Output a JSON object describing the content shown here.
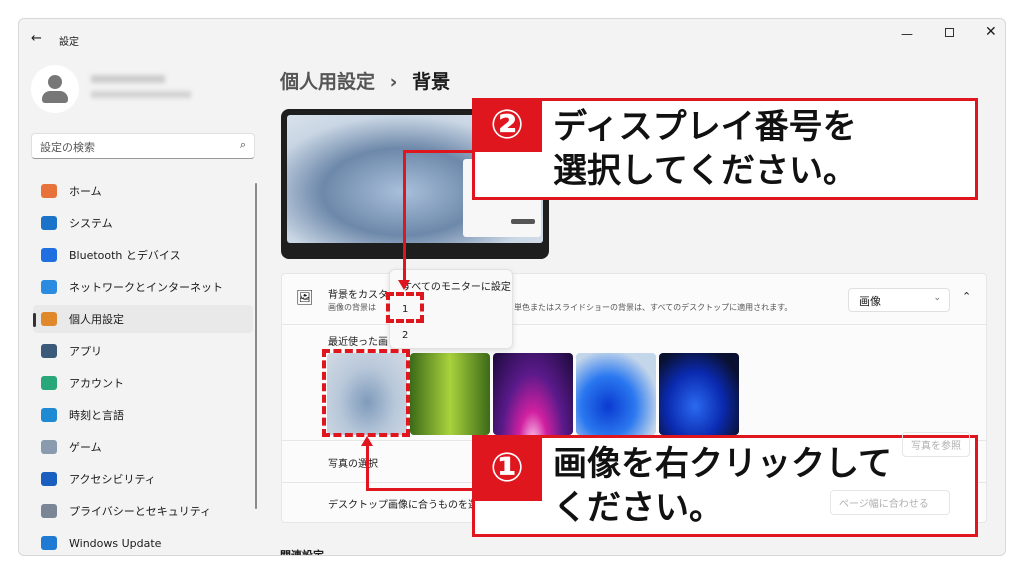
{
  "window": {
    "title": "設定",
    "controls": [
      "minimize",
      "maximize",
      "close"
    ]
  },
  "search": {
    "placeholder": "設定の検索"
  },
  "sidebar": {
    "items": [
      {
        "label": "ホーム",
        "icon": "home-icon",
        "color": "#e8733a"
      },
      {
        "label": "システム",
        "icon": "system-icon",
        "color": "#1a73c9"
      },
      {
        "label": "Bluetooth とデバイス",
        "icon": "bluetooth-icon",
        "color": "#1f6fe0"
      },
      {
        "label": "ネットワークとインターネット",
        "icon": "wifi-icon",
        "color": "#2a8be0"
      },
      {
        "label": "個人用設定",
        "icon": "brush-icon",
        "color": "#e0882c"
      },
      {
        "label": "アプリ",
        "icon": "apps-icon",
        "color": "#3b5a7a"
      },
      {
        "label": "アカウント",
        "icon": "account-icon",
        "color": "#28a77a"
      },
      {
        "label": "時刻と言語",
        "icon": "clock-globe-icon",
        "color": "#1f8ad4"
      },
      {
        "label": "ゲーム",
        "icon": "gamepad-icon",
        "color": "#8a9bb0"
      },
      {
        "label": "アクセシビリティ",
        "icon": "accessibility-icon",
        "color": "#1a5fc0"
      },
      {
        "label": "プライバシーとセキュリティ",
        "icon": "shield-icon",
        "color": "#7a8596"
      },
      {
        "label": "Windows Update",
        "icon": "update-icon",
        "color": "#1f7ad4"
      }
    ],
    "active": 4
  },
  "breadcrumb": {
    "parent": "個人用設定",
    "separator": "›",
    "current": "背景"
  },
  "background_card": {
    "title": "背景をカスタ",
    "desc_left": "画像の背景は",
    "desc_right": "単色またはスライドショーの背景は、すべてのデスクトップに適用されます。",
    "dropdown": "画像",
    "recent_label": "最近使った画",
    "photo_label": "写真の選択",
    "photo_button": "写真を参照",
    "fit_label": "デスクトップ画像に合うものを選択",
    "fit_dropdown": "ページ幅に合わせる"
  },
  "context_menu": {
    "items": [
      "すべてのモニターに設定",
      "1",
      "2"
    ]
  },
  "related": "関連設定",
  "callouts": [
    {
      "num": "①",
      "lines": [
        "画像を右クリックして",
        "ください。"
      ]
    },
    {
      "num": "②",
      "lines": [
        "ディスプレイ番号を",
        "選択してください。"
      ]
    }
  ],
  "colors": {
    "accent": "#e0161e"
  }
}
